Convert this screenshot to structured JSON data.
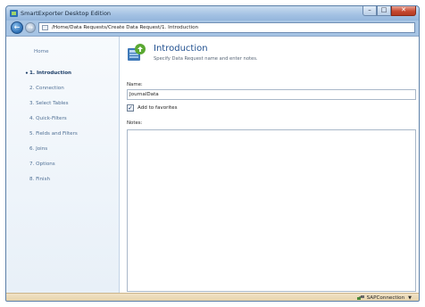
{
  "window": {
    "title": "SmartExporter Desktop Edition",
    "controls": {
      "minimize": "–",
      "maximize": "□",
      "close": "✕"
    }
  },
  "navbar": {
    "back_icon": "arrow-left-icon",
    "forward_icon": "arrow-right-icon",
    "address": "/Home/Data Requests/Create Data Request/1. Introduction"
  },
  "sidebar": {
    "home": "Home",
    "bullet": "•",
    "items": [
      {
        "label": "1. Introduction",
        "active": true
      },
      {
        "label": "2. Connection"
      },
      {
        "label": "3. Select Tables"
      },
      {
        "label": "4. Quick-Filters"
      },
      {
        "label": "5. Fields and Filters"
      },
      {
        "label": "6. Joins"
      },
      {
        "label": "7. Options"
      },
      {
        "label": "8. Finish"
      }
    ]
  },
  "main": {
    "header_title": "Introduction",
    "header_subtitle": "Specify Data Request name and enter notes.",
    "name_label": "Name:",
    "name_value": "JournalData",
    "favorites_label": "Add to favorites",
    "favorites_checked": true,
    "checkmark": "✓",
    "notes_label": "Notes:",
    "notes_value": ""
  },
  "statusbar": {
    "connection": "SAPConnection",
    "caret": "▼"
  },
  "colors": {
    "accent": "#1f4f8f",
    "sidebar_text": "#4f6f94",
    "statusbar": "#e3cfa6"
  }
}
